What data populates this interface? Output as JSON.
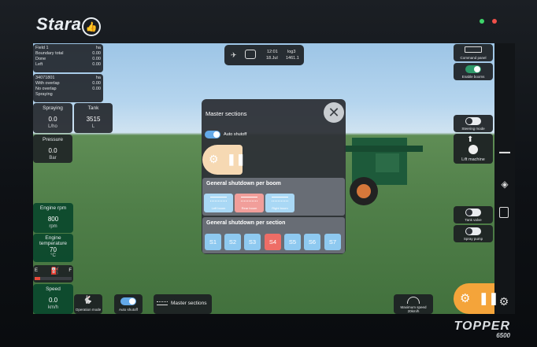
{
  "brand": {
    "name": "Stara",
    "model": "TOPPER",
    "model_number": "6500"
  },
  "status_leds": {
    "green": "#3ed46a",
    "red": "#f0504a"
  },
  "top_bar": {
    "time": "12:01",
    "date": "18.Jul",
    "log_label": "log3",
    "log_value": "1461.1"
  },
  "field_info": {
    "rows": [
      {
        "label": "Field 1",
        "value": "ha"
      },
      {
        "label": "Boundary total",
        "value": "0.00"
      },
      {
        "label": "Done",
        "value": "0.00"
      },
      {
        "label": "Left",
        "value": "0.00"
      }
    ]
  },
  "area_info": {
    "rows": [
      {
        "label": "34071801",
        "value": "ha"
      },
      {
        "label": "With overlap",
        "value": "0.00"
      },
      {
        "label": "No overlap",
        "value": "0.00"
      },
      {
        "label": "Spraying",
        "value": ""
      }
    ]
  },
  "tiles": {
    "spraying": {
      "title": "Spraying",
      "value": "0.0",
      "unit": "L/ho"
    },
    "tank": {
      "title": "Tank",
      "value": "3515",
      "unit": "L"
    },
    "pressure": {
      "title": "Pressure",
      "value": "0.0",
      "unit": "Bar"
    },
    "engine_rpm": {
      "title": "Engine rpm",
      "value": "800",
      "unit": "rpm"
    },
    "engine_temp": {
      "title": "Engine temperature",
      "value": "70",
      "unit": "°C"
    },
    "speed": {
      "title": "Speed",
      "value": "0.0",
      "unit": "km/h"
    }
  },
  "fuel": {
    "empty": "E",
    "full": "F",
    "level": 0.15
  },
  "modal": {
    "title": "Master sections",
    "auto_shutoff_label": "Auto shutoff",
    "auto_shutoff_on": true,
    "per_boom_title": "General shutdown per boom",
    "booms": [
      {
        "label": "Left boom",
        "active": false
      },
      {
        "label": "Rear boom",
        "active": true
      },
      {
        "label": "Right boom",
        "active": false
      }
    ],
    "per_section_title": "General shutdown per section",
    "sections": [
      {
        "label": "S1",
        "active": false
      },
      {
        "label": "S2",
        "active": false
      },
      {
        "label": "S3",
        "active": false
      },
      {
        "label": "S4",
        "active": true
      },
      {
        "label": "S5",
        "active": false
      },
      {
        "label": "S6",
        "active": false
      },
      {
        "label": "S7",
        "active": false
      }
    ]
  },
  "right_controls": {
    "command_panel": "Command panel",
    "enable_booms": "Enable booms",
    "steering_mode": "Steering mode",
    "lift_machine": "Lift machine",
    "tank_valve": "Tank valve",
    "spray_pump": "Spray pump"
  },
  "bottom_bar": {
    "operation_mode": "Operation mode",
    "auto_shutoff": "Auto shutoff",
    "master_sections": "Master sections",
    "max_speed_label": "Maximum speed",
    "max_speed_value": "20km/h"
  },
  "colors": {
    "accent_blue": "#63a9e8",
    "active_red": "#ee6d66",
    "section_blue": "#8ec9f0",
    "play_orange": "#f4a43a"
  }
}
